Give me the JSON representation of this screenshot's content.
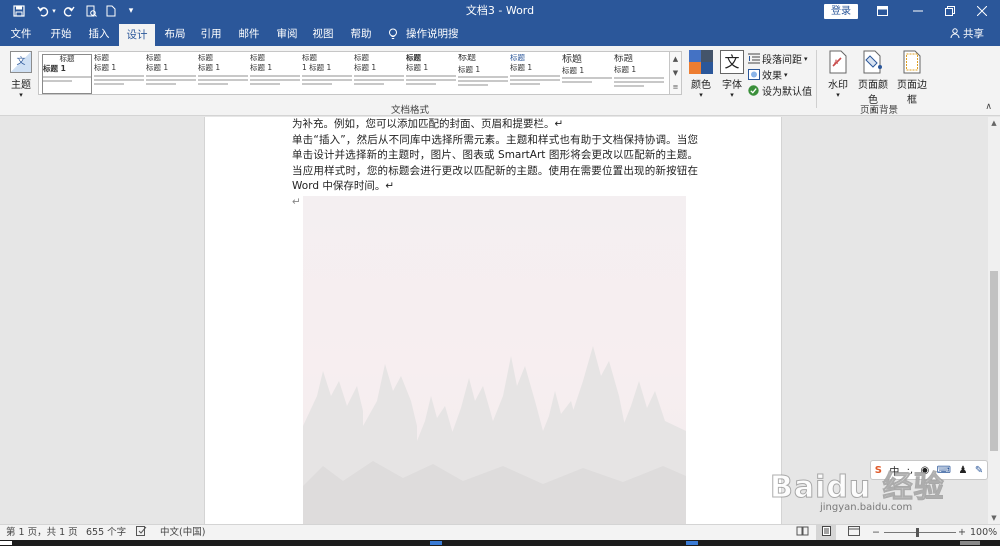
{
  "title_bar": {
    "title": "文档3 - Word",
    "login_label": "登录",
    "quick_access": [
      "save-icon",
      "undo-icon",
      "redo-icon",
      "print-preview-icon",
      "new-document-icon",
      "customize-icon"
    ],
    "window_controls": [
      "ribbon-display-icon",
      "minimize-icon",
      "restore-icon",
      "close-icon"
    ]
  },
  "tabs": {
    "items": [
      "文件",
      "开始",
      "插入",
      "设计",
      "布局",
      "引用",
      "邮件",
      "审阅",
      "视图",
      "帮助"
    ],
    "active": "设计",
    "tell_me": "操作说明搜索",
    "share": "共享"
  },
  "ribbon": {
    "theme_label": "主题",
    "theme_icon_text": "文",
    "group_doc_format": "文档格式",
    "group_page_background": "页面背景",
    "styles": [
      {
        "title": "标题 1",
        "heading": "标题"
      },
      {
        "title": "标题",
        "heading": "标题 1"
      },
      {
        "title": "标题",
        "heading": "标题 1"
      },
      {
        "title": "标题",
        "heading": "标题 1"
      },
      {
        "title": "标题",
        "heading": "标题 1"
      },
      {
        "title": "标题",
        "heading": "1 标题 1"
      },
      {
        "title": "标题",
        "heading": "标题 1"
      },
      {
        "title": "标题",
        "heading": "标题 1"
      },
      {
        "title": "标题",
        "heading": "标题 1"
      },
      {
        "title": "标题",
        "heading": "标题 1"
      },
      {
        "title": "标题",
        "heading": "标题 1"
      },
      {
        "title": "标题",
        "heading": "标题 1"
      }
    ],
    "colors_label": "颜色",
    "fonts_label": "字体",
    "fonts_icon_text": "文",
    "paragraph_spacing": "段落间距",
    "effects": "效果",
    "set_default": "设为默认值",
    "watermark": "水印",
    "page_color": "页面颜色",
    "page_borders": "页面边框"
  },
  "document": {
    "paragraphs": [
      "为补充。例如，您可以添加匹配的封面、页眉和提要栏。↵",
      "单击“插入”，然后从不同库中选择所需元素。主题和样式也有助于文档保持协调。当您单击设计并选择新的主题时，图片、图表或 SmartArt 图形将会更改以匹配新的主题。当应用样式时，您的标题会进行更改以匹配新的主题。使用在需要位置出现的新按钮在 Word 中保存时间。↵",
      "↵"
    ]
  },
  "watermark_overlay": {
    "logo": "Baidu 经验",
    "url": "jingyan.baidu.com"
  },
  "status_bar": {
    "page": "第 1 页，共 1 页",
    "words": "655 个字",
    "language": "中文(中国)",
    "zoom": "100%",
    "zoom_minus": "−",
    "zoom_plus": "+"
  },
  "colors": {
    "accent": "#2b579a",
    "ribbon_bg": "#f3f3f3",
    "doc_bg": "#e6e6e6"
  }
}
